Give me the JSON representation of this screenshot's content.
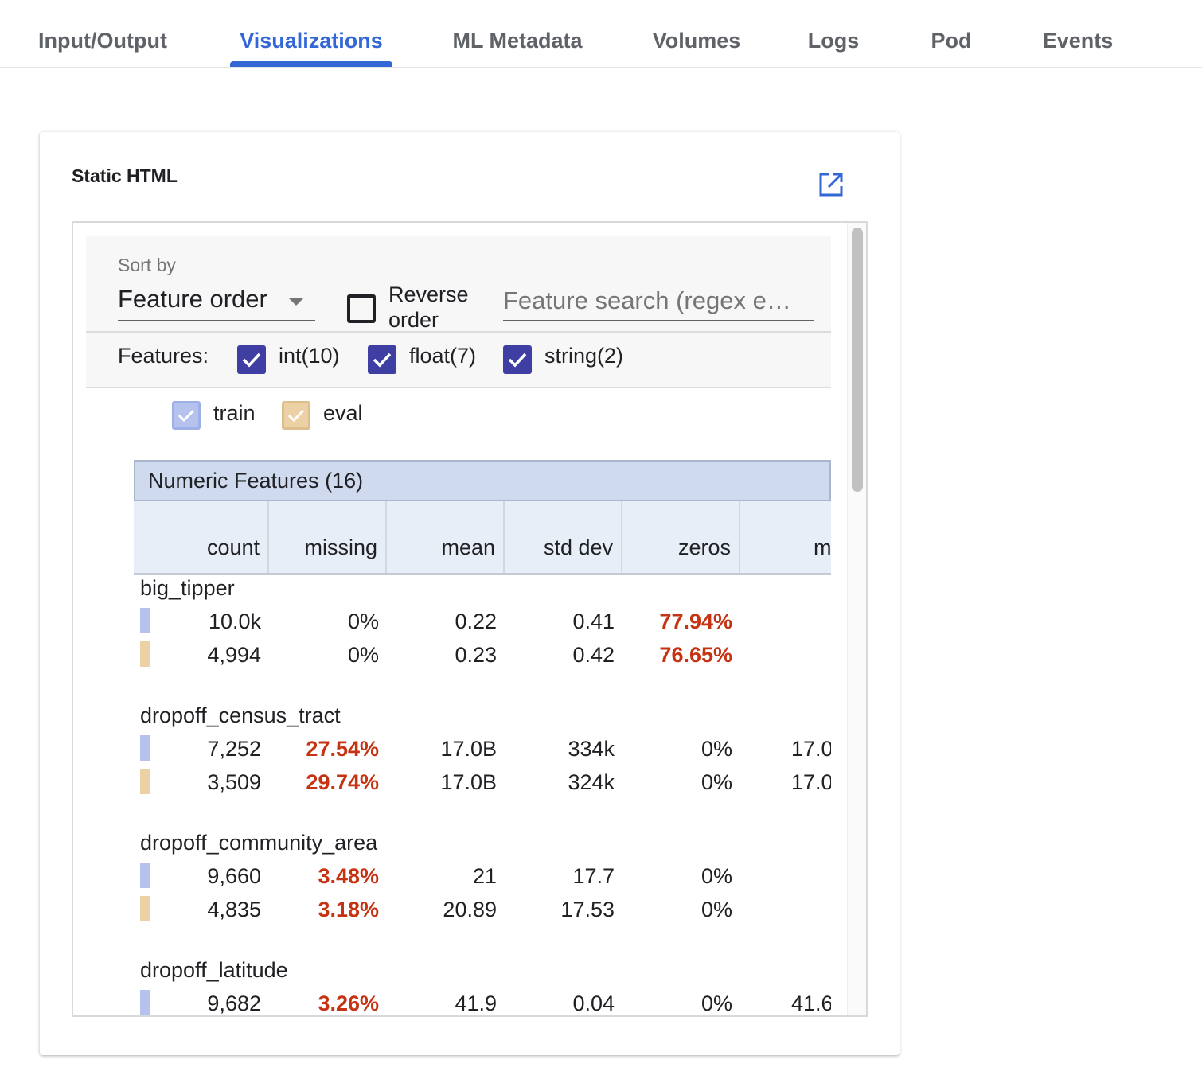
{
  "tabs": [
    {
      "label": "Input/Output"
    },
    {
      "label": "Visualizations"
    },
    {
      "label": "ML Metadata"
    },
    {
      "label": "Volumes"
    },
    {
      "label": "Logs"
    },
    {
      "label": "Pod"
    },
    {
      "label": "Events"
    }
  ],
  "active_tab": "Visualizations",
  "card": {
    "title": "Static HTML",
    "popout_icon": "open-in-new-icon"
  },
  "controls": {
    "sort_label": "Sort by",
    "sort_value": "Feature order",
    "reverse_label_line1": "Reverse",
    "reverse_label_line2": "order",
    "reverse_checked": false,
    "search_placeholder": "Feature search (regex e…",
    "features_label": "Features:",
    "feature_types": [
      {
        "label": "int(10)",
        "checked": true
      },
      {
        "label": "float(7)",
        "checked": true
      },
      {
        "label": "string(2)",
        "checked": true
      }
    ],
    "datasets": [
      {
        "label": "train",
        "color": "#b6c2ee",
        "checked": true
      },
      {
        "label": "eval",
        "color": "#ecd1a4",
        "checked": true
      }
    ]
  },
  "table": {
    "section_title": "Numeric Features (16)",
    "columns": [
      "count",
      "missing",
      "mean",
      "std dev",
      "zeros",
      "m"
    ],
    "highlight_color": "#c53313",
    "features": [
      {
        "name": "big_tipper",
        "rows": [
          {
            "dataset": "train",
            "count": "10.0k",
            "missing": "0%",
            "mean": "0.22",
            "std_dev": "0.41",
            "zeros": "77.94%",
            "min": ""
          },
          {
            "dataset": "eval",
            "count": "4,994",
            "missing": "0%",
            "mean": "0.23",
            "std_dev": "0.42",
            "zeros": "76.65%",
            "min": ""
          }
        ]
      },
      {
        "name": "dropoff_census_tract",
        "rows": [
          {
            "dataset": "train",
            "count": "7,252",
            "missing": "27.54%",
            "mean": "17.0B",
            "std_dev": "334k",
            "zeros": "0%",
            "min": "17.0"
          },
          {
            "dataset": "eval",
            "count": "3,509",
            "missing": "29.74%",
            "mean": "17.0B",
            "std_dev": "324k",
            "zeros": "0%",
            "min": "17.0"
          }
        ]
      },
      {
        "name": "dropoff_community_area",
        "rows": [
          {
            "dataset": "train",
            "count": "9,660",
            "missing": "3.48%",
            "mean": "21",
            "std_dev": "17.7",
            "zeros": "0%",
            "min": ""
          },
          {
            "dataset": "eval",
            "count": "4,835",
            "missing": "3.18%",
            "mean": "20.89",
            "std_dev": "17.53",
            "zeros": "0%",
            "min": ""
          }
        ]
      },
      {
        "name": "dropoff_latitude",
        "rows": [
          {
            "dataset": "train",
            "count": "9,682",
            "missing": "3.26%",
            "mean": "41.9",
            "std_dev": "0.04",
            "zeros": "0%",
            "min": "41.6"
          }
        ]
      }
    ]
  }
}
